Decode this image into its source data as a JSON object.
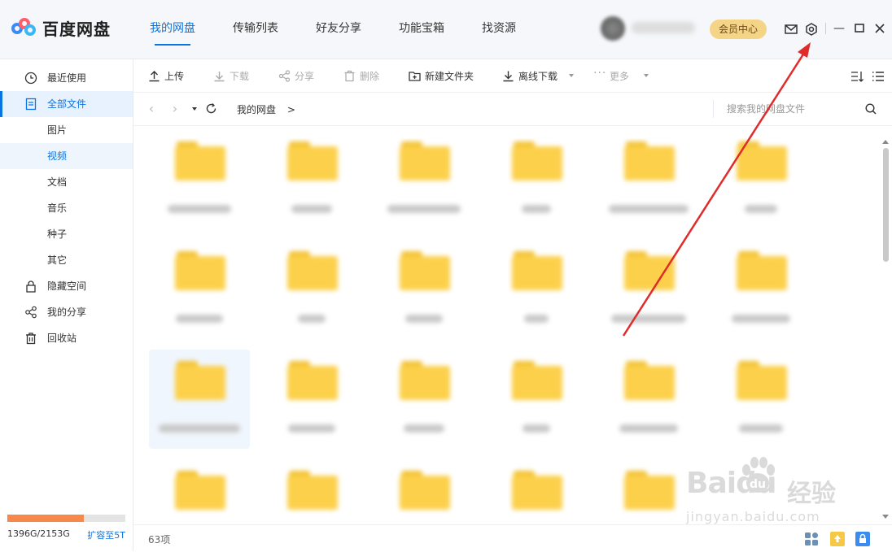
{
  "app": {
    "title": "百度网盘"
  },
  "topnav": {
    "tabs": [
      {
        "label": "我的网盘",
        "active": true
      },
      {
        "label": "传输列表",
        "active": false
      },
      {
        "label": "好友分享",
        "active": false
      },
      {
        "label": "功能宝箱",
        "active": false
      },
      {
        "label": "找资源",
        "active": false
      }
    ],
    "vip_label": "会员中心",
    "icons": [
      "mail-icon",
      "settings-icon",
      "minimize-icon",
      "maximize-icon",
      "close-icon"
    ]
  },
  "sidebar": {
    "items": [
      {
        "label": "最近使用",
        "icon": "clock-icon"
      },
      {
        "label": "全部文件",
        "icon": "file-icon",
        "active": true
      },
      {
        "label": "图片"
      },
      {
        "label": "视频",
        "sub_active": true
      },
      {
        "label": "文档"
      },
      {
        "label": "音乐"
      },
      {
        "label": "种子"
      },
      {
        "label": "其它"
      },
      {
        "label": "隐藏空间",
        "icon": "lock-icon"
      },
      {
        "label": "我的分享",
        "icon": "share-icon"
      },
      {
        "label": "回收站",
        "icon": "trash-icon"
      }
    ],
    "storage": {
      "used_label": "1396G/2153G",
      "expand_label": "扩容至5T",
      "used_fraction": 0.648
    }
  },
  "toolbar": {
    "upload": "上传",
    "download": "下载",
    "share": "分享",
    "delete": "删除",
    "new_folder": "新建文件夹",
    "offline_download": "离线下载",
    "more": "更多"
  },
  "address": {
    "breadcrumb": "我的网盘",
    "separator": ">",
    "search_placeholder": "搜索我的网盘文件"
  },
  "status": {
    "count": "63项"
  },
  "watermark": {
    "logo": "Baidu",
    "cn": "经验",
    "url": "jingyan.baidu.com"
  },
  "colors": {
    "accent": "#0b74e3",
    "folder": "#fcd04a",
    "storage": "#f6894a",
    "arrow": "#e02b2b"
  }
}
